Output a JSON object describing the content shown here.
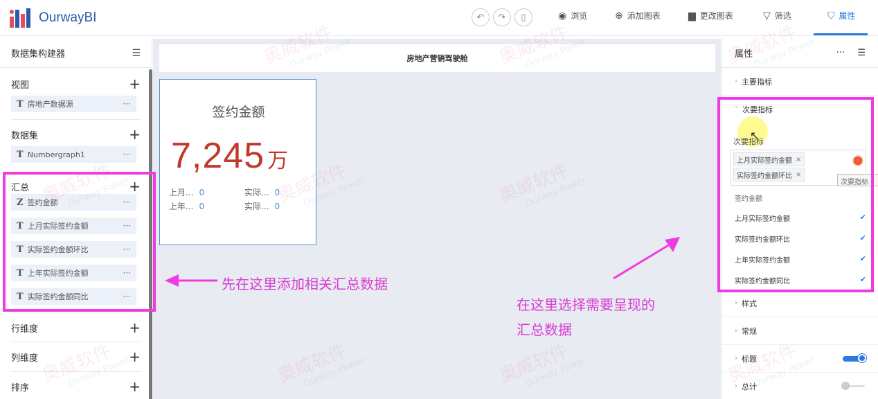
{
  "app": {
    "brand": "OurwayBI"
  },
  "toolbar": {
    "undo_icon": "undo-icon",
    "redo_icon": "redo-icon",
    "device_icon": "mobile-preview-icon",
    "preview": "浏览",
    "add_chart": "添加图表",
    "change_chart": "更改图表",
    "filter": "筛选",
    "properties": "属性"
  },
  "left": {
    "title": "数据集构建器",
    "sections": {
      "view": {
        "title": "视图",
        "fields": [
          "房地产数据源"
        ]
      },
      "dataset": {
        "title": "数据集",
        "fields": [
          "Numbergraph1"
        ]
      },
      "summary": {
        "title": "汇总",
        "fields": [
          {
            "type": "Z",
            "label": "签约金额"
          },
          {
            "type": "T",
            "label": "上月实际签约金额"
          },
          {
            "type": "T",
            "label": "实际签约金额环比"
          },
          {
            "type": "T",
            "label": "上年实际签约金额"
          },
          {
            "type": "T",
            "label": "实际签约金额同比"
          }
        ]
      },
      "row_dim": {
        "title": "行维度"
      },
      "col_dim": {
        "title": "列维度"
      },
      "sort": {
        "title": "排序"
      }
    }
  },
  "canvas": {
    "title": "房地产营销驾驶舱",
    "card": {
      "title": "签约金额",
      "value": "7,245",
      "unit": "万",
      "subs": [
        {
          "label": "上月...",
          "value": "0"
        },
        {
          "label": "实际...",
          "value": "0"
        },
        {
          "label": "上年...",
          "value": "0"
        },
        {
          "label": "实际...",
          "value": "0"
        }
      ]
    }
  },
  "right": {
    "title": "属性",
    "sections": {
      "main": "主要指标",
      "secondary": "次要指标",
      "style": "样式",
      "general": "常规",
      "title": "标题",
      "total": "总计"
    },
    "secondary_label": "次要指标",
    "selected_tags": [
      "上月实际签约金额",
      "实际签约金额环比"
    ],
    "tooltip": "次要指标",
    "options": [
      {
        "label": "签约金额",
        "checked": false
      },
      {
        "label": "上月实际签约金额",
        "checked": true
      },
      {
        "label": "实际签约金额环比",
        "checked": true
      },
      {
        "label": "上年实际签约金额",
        "checked": true
      },
      {
        "label": "实际签约金额同比",
        "checked": true
      }
    ],
    "title_toggle": true,
    "total_toggle": false,
    "accent": "#2a7ae2"
  },
  "annotations": {
    "left": "先在这里添加相关汇总数据",
    "right_line1": "在这里选择需要呈现的",
    "right_line2": "汇总数据",
    "color": "#ee3ce2"
  },
  "watermark": {
    "cn": "奥威软件",
    "en": "Ourway Power"
  }
}
